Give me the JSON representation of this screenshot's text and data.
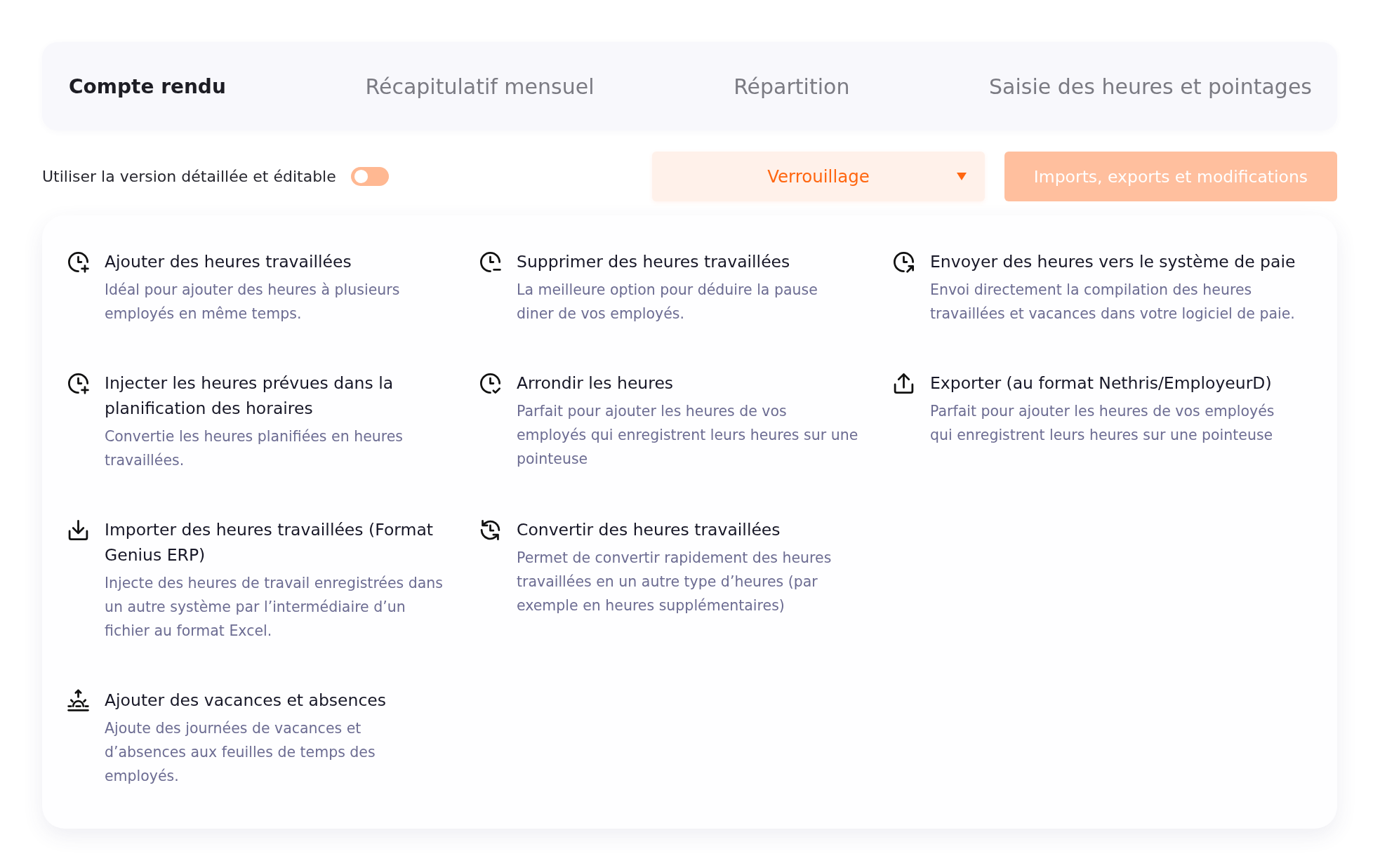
{
  "tabs": [
    {
      "label": "Compte rendu",
      "selected": true
    },
    {
      "label": "Récapitulatif mensuel",
      "selected": false
    },
    {
      "label": "Répartition",
      "selected": false
    },
    {
      "label": "Saisie des heures et pointages",
      "selected": false
    }
  ],
  "toolbar": {
    "toggle": {
      "label": "Utiliser la version détaillée et éditable",
      "on": false
    },
    "dropdown": {
      "value": "Verrouillage"
    },
    "button": {
      "label": "Imports, exports et modifications"
    }
  },
  "action_rows": [
    [
      {
        "kind": "clockplus",
        "title": "Ajouter des heures travaillées",
        "description": "Idéal pour ajouter des heures à plusieurs employés en même temps."
      },
      {
        "kind": "clockminus",
        "title": "Supprimer des heures travaillées",
        "description": "La meilleure option pour déduire la pause diner de vos employés."
      },
      {
        "kind": "clocksend",
        "title": "Envoyer des heures vers le système de paie",
        "description": "Envoi directement la compilation des heures travaillées et vacances dans votre logiciel de paie."
      }
    ],
    [
      {
        "kind": "clockplus",
        "title": "Injecter les heures prévues dans la planification des horaires",
        "description": "Convertie les heures planifiées en heures travaillées."
      },
      {
        "kind": "clockcheck",
        "title": "Arrondir les heures",
        "description": "Parfait pour ajouter les heures de vos employés qui enregistrent leurs heures sur une pointeuse"
      },
      {
        "kind": "upload",
        "title": "Exporter (au format Nethris/EmployeurD)",
        "description": "Parfait pour ajouter les heures de vos employés qui enregistrent leurs heures sur une pointeuse"
      }
    ],
    [
      {
        "kind": "download",
        "title": "Importer des heures travaillées (Format Genius ERP)",
        "description": "Injecte des heures de travail enregistrées dans un autre système par l’intermédiaire d’un fichier au format Excel."
      },
      {
        "kind": "clocksync",
        "title": "Convertir des heures travaillées",
        "description": "Permet de convertir rapidement des heures travaillées en un autre type d’heures (par exemple en heures supplémentaires)"
      }
    ],
    [
      {
        "kind": "sunrise",
        "title": "Ajouter des vacances et absences",
        "description": "Ajoute des journées de vacances et d’absences aux feuilles de temps des employés."
      }
    ]
  ]
}
